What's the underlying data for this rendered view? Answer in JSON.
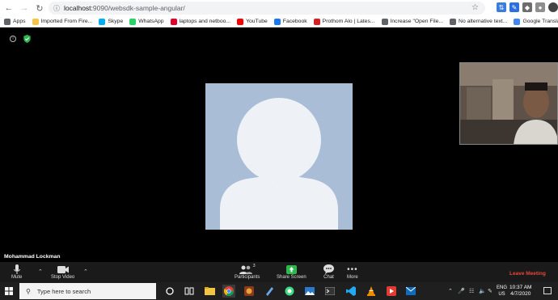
{
  "browser": {
    "url_host": "localhost:",
    "url_rest": "9090/websdk-sample-angular/"
  },
  "bookmarks": [
    {
      "label": "Apps",
      "icon": "apps-grid-icon",
      "color": "#5f6368"
    },
    {
      "label": "Imported From Fire...",
      "icon": "folder-icon",
      "color": "#f4c542"
    },
    {
      "label": "Skype",
      "icon": "skype-icon",
      "color": "#00aff0"
    },
    {
      "label": "WhatsApp",
      "icon": "whatsapp-icon",
      "color": "#25d366"
    },
    {
      "label": "laptops and netboo...",
      "icon": "l-logo-icon",
      "color": "#e4002b"
    },
    {
      "label": "YouTube",
      "icon": "youtube-icon",
      "color": "#ff0000"
    },
    {
      "label": "Facebook",
      "icon": "facebook-icon",
      "color": "#1877f2"
    },
    {
      "label": "Prothom Alo | Lates...",
      "icon": "prothom-alo-icon",
      "color": "#d62027"
    },
    {
      "label": "Increase \"Open File...",
      "icon": "gear-icon",
      "color": "#5f6368"
    },
    {
      "label": "No alternative text...",
      "icon": "globe-icon",
      "color": "#5f6368"
    },
    {
      "label": "Google Translate",
      "icon": "google-translate-icon",
      "color": "#4285f4"
    }
  ],
  "meeting": {
    "speaker_name": "Mohammad Lockman",
    "avatar_bg": "#a9bdd6",
    "avatar_fg": "#eef2f7"
  },
  "toolbar": {
    "mute": "Mute",
    "stop_video": "Stop Video",
    "participants": "Participants",
    "participants_count": "3",
    "share_screen": "Share Screen",
    "chat": "Chat",
    "more": "More",
    "leave": "Leave Meeting",
    "share_color": "#2db84d",
    "leave_color": "#e8473b"
  },
  "taskbar": {
    "search_placeholder": "Type here to search",
    "lang_line1": "ENG",
    "lang_line2": "US",
    "time": "10:37 AM",
    "date": "4/7/2020"
  }
}
